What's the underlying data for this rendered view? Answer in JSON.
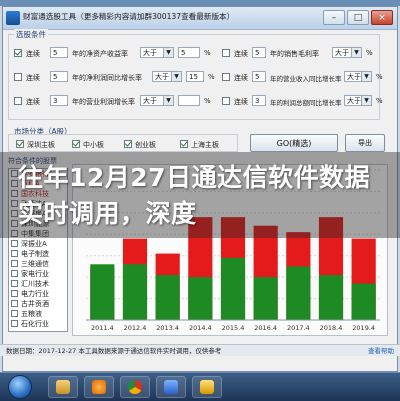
{
  "window": {
    "title": "财富通选股工具（更多精彩内容请加群300137查看最新版本）"
  },
  "conditions": {
    "group_title": "选股条件",
    "rows": [
      {
        "checked": true,
        "label_a": "连续",
        "days": "5",
        "label_b": "年的净资产收益率",
        "op": "大于",
        "value": "5",
        "unit": "%",
        "label_c": "连续",
        "days2": "5",
        "label_d": "年的销售毛利率",
        "op2": "大于",
        "unit2": "%"
      },
      {
        "checked": false,
        "label_a": "连续",
        "days": "5",
        "label_b": "年的净利润同比增长率",
        "op": "大于",
        "value": "15",
        "unit": "%",
        "label_c": "连续",
        "days2": "5",
        "label_d": "年的营业收入同比增长率",
        "op2": "大于",
        "unit2": "%"
      },
      {
        "checked": false,
        "label_a": "连续",
        "days": "3",
        "label_b": "年的营业利润增长率",
        "op": "大于",
        "value": "",
        "unit": "%",
        "label_c": "连续",
        "days2": "3",
        "label_d": "年的利润总额同比增长率",
        "op2": "大于",
        "unit2": "%"
      }
    ]
  },
  "market": {
    "title": "市场分类（A股）",
    "items": [
      {
        "checked": true,
        "label": "深圳主板"
      },
      {
        "checked": true,
        "label": "中小板"
      },
      {
        "checked": true,
        "label": "创业板"
      },
      {
        "checked": true,
        "label": "上海主板"
      }
    ],
    "go_label": "GO(精选)",
    "small_label": "导出"
  },
  "list": {
    "title": "符合条件的股票",
    "items": [
      {
        "label": "平安银行",
        "red": true
      },
      {
        "label": "万科A",
        "red": true
      },
      {
        "label": "国农科技",
        "red": true
      },
      {
        "label": "飞亚达A",
        "red": false
      },
      {
        "label": "深深房A",
        "red": false
      },
      {
        "label": "深圳能源",
        "red": false
      },
      {
        "label": "中集集团",
        "red": false
      },
      {
        "label": "深振业A",
        "red": false
      },
      {
        "label": "电子制造",
        "red": false
      },
      {
        "label": "三维通信",
        "red": false
      },
      {
        "label": "家电行业",
        "red": false
      },
      {
        "label": "汇川技术",
        "red": false
      },
      {
        "label": "电力行业",
        "red": false
      },
      {
        "label": "古井贡酒",
        "red": false
      },
      {
        "label": "五粮液",
        "red": false
      },
      {
        "label": "石化行业",
        "red": false
      }
    ]
  },
  "chart_data": {
    "type": "bar",
    "categories": [
      "2011.4",
      "2012.4",
      "2013.4",
      "2014.4",
      "2015.4",
      "2016.4",
      "2017.4",
      "2018.4",
      "2019.4"
    ],
    "series": [
      {
        "values": [
          24,
          38,
          31,
          48,
          48,
          44,
          41,
          48,
          38
        ],
        "color": "#e31b1b"
      },
      {
        "values": [
          26,
          26,
          21,
          20,
          29,
          20,
          25,
          21,
          17
        ],
        "color": "#1e8a23"
      }
    ],
    "ylim": [
      0,
      70
    ],
    "grid": true
  },
  "status": {
    "left": "数据日期：2017-12-27 本工具数据来源于通达信软件实时调用，仅供参考",
    "right": "查看帮助"
  },
  "headline": {
    "text": "往年12月27日通达信软件数据实时调用，深度"
  },
  "colors": {
    "accent": "#1f5fb4",
    "bar_red": "#e31b1b",
    "bar_green": "#1e8a23"
  },
  "taskbar": {
    "apps": [
      "explorer-icon",
      "media-player-icon",
      "chrome-icon",
      "app-icon",
      "stock-app-icon"
    ]
  }
}
